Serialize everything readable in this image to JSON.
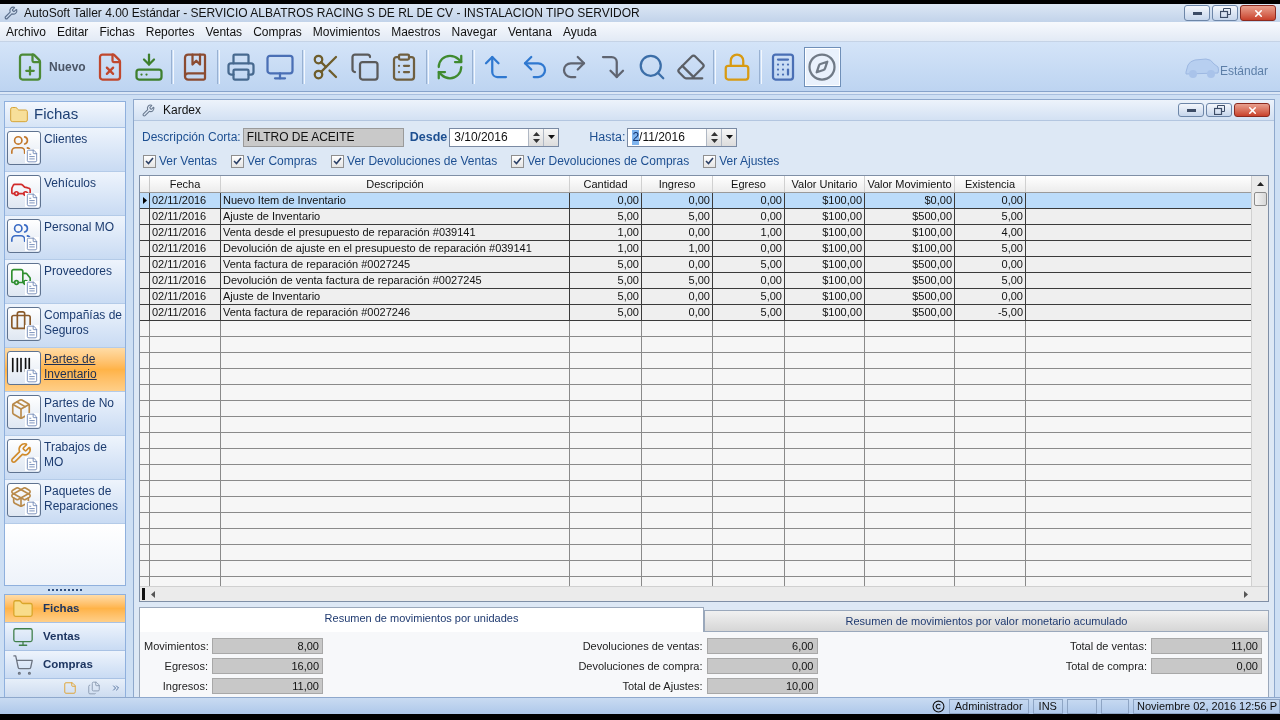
{
  "window": {
    "title": "AutoSoft Taller 4.00 Estándar - SERVICIO ALBATROS RACING S DE RL DE CV - INSTALACION TIPO SERVIDOR"
  },
  "menu": [
    "Archivo",
    "Editar",
    "Fichas",
    "Reportes",
    "Ventas",
    "Compras",
    "Movimientos",
    "Maestros",
    "Navegar",
    "Ventana",
    "Ayuda"
  ],
  "toolbar": {
    "groups": [
      [
        {
          "label": "Nuevo",
          "pressed": false
        },
        {
          "pressed": false
        },
        {
          "pressed": false
        }
      ],
      [
        {
          "pressed": false
        }
      ],
      [
        {
          "pressed": false
        },
        {
          "pressed": false
        }
      ],
      [
        {
          "pressed": false
        },
        {
          "pressed": false
        },
        {
          "pressed": false
        }
      ],
      [
        {
          "pressed": false
        }
      ],
      [
        {
          "pressed": false
        },
        {
          "pressed": false
        },
        {
          "pressed": false
        },
        {
          "pressed": false
        },
        {
          "pressed": false
        },
        {
          "pressed": false
        }
      ],
      [
        {
          "pressed": false
        }
      ],
      [
        {
          "pressed": false
        },
        {
          "pressed": true
        }
      ]
    ],
    "edition": "Estándar"
  },
  "sidebar": {
    "title": "Fichas",
    "items": [
      {
        "label": "Clientes",
        "selected": false
      },
      {
        "label": "Vehículos",
        "selected": false
      },
      {
        "label": "Personal MO",
        "selected": false
      },
      {
        "label": "Proveedores",
        "selected": false
      },
      {
        "label": "Compañías de Seguros",
        "selected": false
      },
      {
        "label": "Partes de Inventario",
        "selected": true
      },
      {
        "label": "Partes de No Inventario",
        "selected": false
      },
      {
        "label": "Trabajos de MO",
        "selected": false
      },
      {
        "label": "Paquetes de Reparaciones",
        "selected": false
      }
    ],
    "nav": [
      {
        "label": "Fichas",
        "selected": true
      },
      {
        "label": "Ventas",
        "selected": false
      },
      {
        "label": "Compras",
        "selected": false
      }
    ]
  },
  "kardex": {
    "title": "Kardex",
    "description": {
      "label": "Descripción Corta:",
      "value": "FILTRO DE ACEITE"
    },
    "desde": {
      "label": "Desde",
      "segments": [
        {
          "text": "3/10/2016",
          "selected": false
        }
      ]
    },
    "hasta": {
      "label": "Hasta:",
      "segments": [
        {
          "text": "2",
          "selected": true
        },
        {
          "text": "/11/2016",
          "selected": false
        }
      ]
    },
    "checks": [
      {
        "label": "Ver Ventas",
        "checked": true
      },
      {
        "label": "Ver Compras",
        "checked": true
      },
      {
        "label": "Ver Devoluciones de Ventas",
        "checked": true
      },
      {
        "label": "Ver Devoluciones de Compras",
        "checked": true
      },
      {
        "label": "Ver Ajustes",
        "checked": true
      }
    ]
  },
  "table": {
    "columns": [
      "Fecha",
      "Descripción",
      "Cantidad",
      "Ingreso",
      "Egreso",
      "Valor Unitario",
      "Valor Movimiento",
      "Existencia"
    ],
    "rows": [
      {
        "selected": true,
        "cells": [
          "02/11/2016",
          "Nuevo Item de Inventario",
          "0,00",
          "0,00",
          "0,00",
          "$100,00",
          "$0,00",
          "0,00"
        ]
      },
      {
        "selected": false,
        "cells": [
          "02/11/2016",
          "Ajuste de Inventario",
          "5,00",
          "5,00",
          "0,00",
          "$100,00",
          "$500,00",
          "5,00"
        ]
      },
      {
        "selected": false,
        "cells": [
          "02/11/2016",
          "Venta desde el presupuesto de reparación #039141",
          "1,00",
          "0,00",
          "1,00",
          "$100,00",
          "$100,00",
          "4,00"
        ]
      },
      {
        "selected": false,
        "cells": [
          "02/11/2016",
          "Devolución de ajuste en el presupuesto de reparación #039141",
          "1,00",
          "1,00",
          "0,00",
          "$100,00",
          "$100,00",
          "5,00"
        ]
      },
      {
        "selected": false,
        "cells": [
          "02/11/2016",
          "Venta factura de reparación #0027245",
          "5,00",
          "0,00",
          "5,00",
          "$100,00",
          "$500,00",
          "0,00"
        ]
      },
      {
        "selected": false,
        "cells": [
          "02/11/2016",
          "Devolución de venta factura de reparación #0027245",
          "5,00",
          "5,00",
          "0,00",
          "$100,00",
          "$500,00",
          "5,00"
        ]
      },
      {
        "selected": false,
        "cells": [
          "02/11/2016",
          "Ajuste de Inventario",
          "5,00",
          "0,00",
          "5,00",
          "$100,00",
          "$500,00",
          "0,00"
        ]
      },
      {
        "selected": false,
        "cells": [
          "02/11/2016",
          "Venta factura de reparación #0027246",
          "5,00",
          "0,00",
          "5,00",
          "$100,00",
          "$500,00",
          "-5,00"
        ]
      }
    ]
  },
  "summary": {
    "tabs": [
      {
        "label": "Resumen de movimientos por unidades",
        "selected": true
      },
      {
        "label": "Resumen de movimientos por valor monetario acumulado",
        "selected": false
      }
    ],
    "columns": [
      [
        {
          "label": "Movimientos:",
          "value": "8,00"
        },
        {
          "label": "Egresos:",
          "value": "16,00"
        },
        {
          "label": "Ingresos:",
          "value": "11,00"
        }
      ],
      [
        {
          "label": "Devoluciones de ventas:",
          "value": "6,00"
        },
        {
          "label": "Devoluciones de compra:",
          "value": "0,00"
        },
        {
          "label": "Total de Ajustes:",
          "value": "10,00"
        }
      ],
      [
        {
          "label": "Total de ventas:",
          "value": "11,00"
        },
        {
          "label": "Total de compra:",
          "value": "0,00"
        }
      ]
    ]
  },
  "status_bar": {
    "user": "Administrador",
    "mode": "INS",
    "datetime": "Noviembre 02, 2016 12:56 P"
  }
}
